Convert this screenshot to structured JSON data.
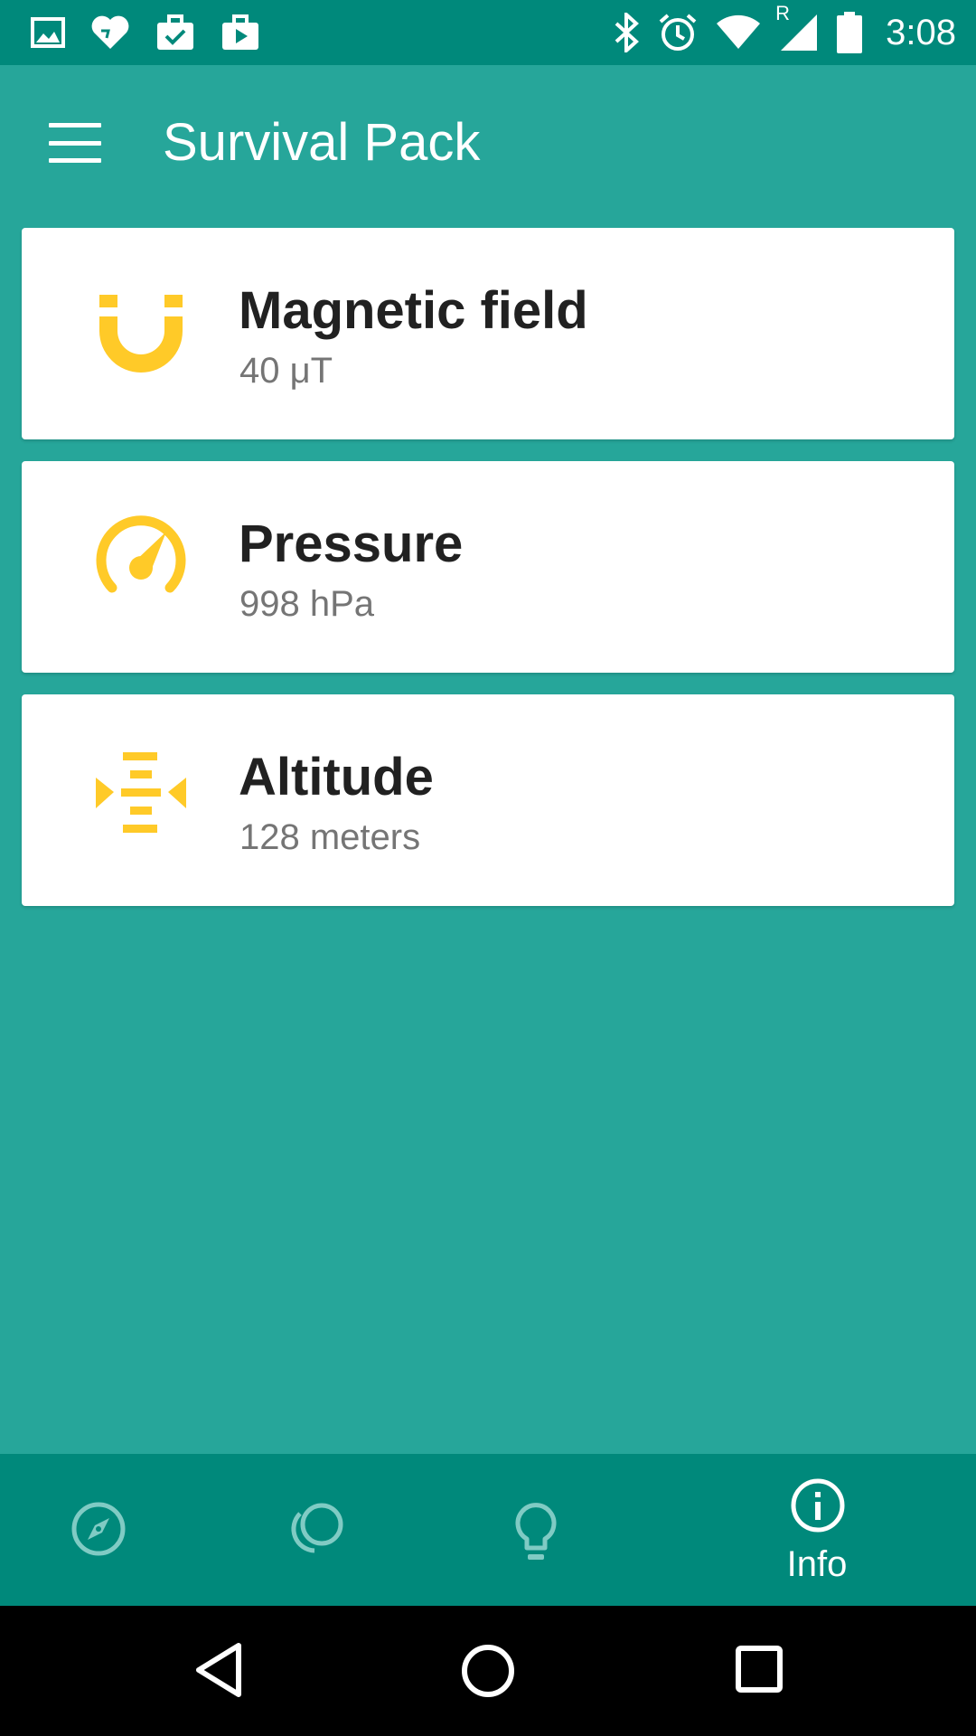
{
  "status_bar": {
    "time": "3:08",
    "roaming_label": "R",
    "left_icons": [
      "image-icon",
      "heart-icon",
      "briefcase-check-icon",
      "briefcase-play-icon"
    ],
    "right_icons": [
      "bluetooth-icon",
      "alarm-icon",
      "wifi-icon",
      "signal-icon",
      "battery-icon"
    ]
  },
  "app_bar": {
    "title": "Survival Pack",
    "menu_icon": "hamburger-menu-icon"
  },
  "sensors": [
    {
      "title": "Magnetic field",
      "value": "40 μT",
      "icon": "magnet-icon"
    },
    {
      "title": "Pressure",
      "value": "998 hPa",
      "icon": "gauge-icon"
    },
    {
      "title": "Altitude",
      "value": "128 meters",
      "icon": "altitude-icon"
    }
  ],
  "bottom_nav": {
    "items": [
      {
        "icon": "compass-icon",
        "label": "",
        "active": false
      },
      {
        "icon": "circles-icon",
        "label": "",
        "active": false
      },
      {
        "icon": "lightbulb-icon",
        "label": "",
        "active": false
      },
      {
        "icon": "info-icon",
        "label": "Info",
        "active": true
      }
    ]
  },
  "system_nav": [
    "back-icon",
    "home-icon",
    "recents-icon"
  ],
  "colors": {
    "primary": "#26A69A",
    "primary_dark": "#00897B",
    "accent": "#FFCA28",
    "card": "#FFFFFF",
    "title_text": "#212121",
    "secondary_text": "#757575"
  }
}
